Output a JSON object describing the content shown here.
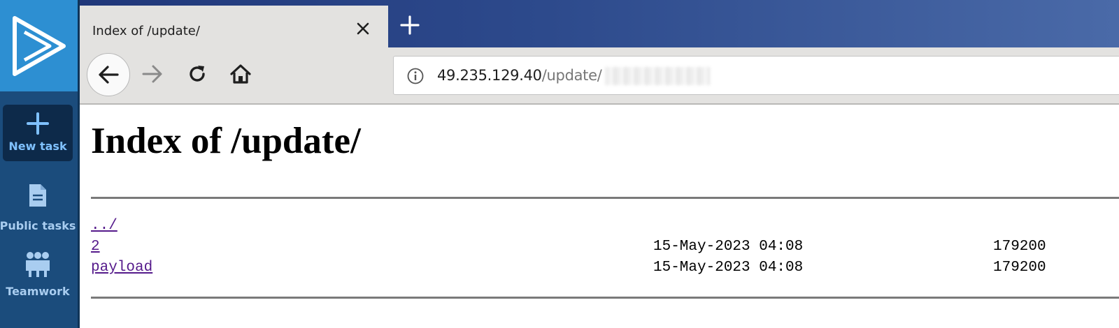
{
  "sidebar": {
    "logo_icon": "play-triangle-logo",
    "new_task": {
      "label": "New task",
      "icon": "plus-icon"
    },
    "public_tasks": {
      "label": "Public tasks",
      "icon": "document-icon"
    },
    "teamwork": {
      "label": "Teamwork",
      "icon": "people-icon"
    }
  },
  "browser": {
    "tab": {
      "title": "Index of /update/",
      "close_icon": "close-icon"
    },
    "new_tab_icon": "plus-icon",
    "nav": {
      "back_icon": "arrow-left-icon",
      "forward_icon": "arrow-right-icon",
      "reload_icon": "reload-icon",
      "home_icon": "home-icon"
    },
    "address": {
      "info_icon": "info-icon",
      "host": "49.235.129.40",
      "path": "/update/"
    }
  },
  "page": {
    "title": "Index of /update/",
    "entries": [
      {
        "name": "../",
        "date": "",
        "size": ""
      },
      {
        "name": "2",
        "date": "15-May-2023 04:08",
        "size": "179200"
      },
      {
        "name": "payload",
        "date": "15-May-2023 04:08",
        "size": "179200"
      }
    ]
  },
  "colors": {
    "sidebar_bg": "#1b4c7c",
    "logo_bg": "#2d8fd2",
    "link_visited": "#551a8b",
    "tabstrip": "#20377a"
  }
}
